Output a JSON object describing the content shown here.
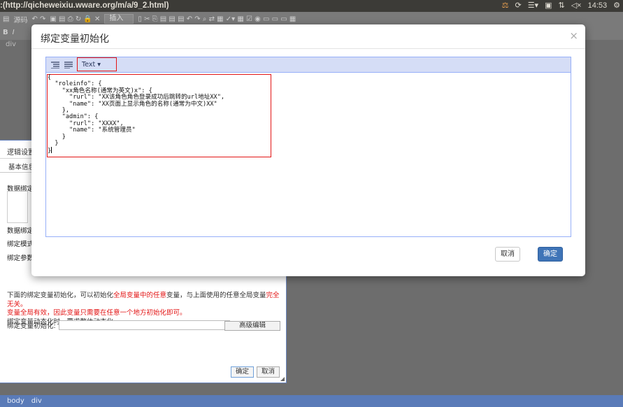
{
  "window": {
    "title": ":(http://qicheweixiu.wware.org/m/a/9_2.html)",
    "time": "14:53"
  },
  "bg_toolbar": {
    "source_label": "源码",
    "insert_label": "插入",
    "bold_label": "B",
    "italic_label": "I",
    "path_tag": "div"
  },
  "logic_dialog": {
    "title": "逻辑设置",
    "tab": "基本信息",
    "label_data_bind": "数据绑定",
    "label_data_bind2": "数据绑定",
    "label_mode": "绑定模式:",
    "label_params": "绑定参数:",
    "info_line1_a": "下面的绑定变量初始化，可以初始化",
    "info_line1_red1": "全局变量中的任意",
    "info_line1_b": "变量，与上面使用的任意全局变量",
    "info_line1_red2": "完全无关。",
    "info_line2": "变量全局有效，因此变量只需要在任意一个地方初始化即可。",
    "info_line3": "绑定变量动态化时，要求整体动态化。",
    "init_label": "绑定变量初始化:",
    "advanced_button": "高级编辑",
    "ok_button": "确定",
    "cancel_button": "取消"
  },
  "status_bar": {
    "path1": "body",
    "path2": "div"
  },
  "modal": {
    "title": "绑定变量初始化",
    "close": "×",
    "mode_label": "Text ▾",
    "code_lines": [
      "{",
      "  \"roleinfo\": {",
      "    \"xx角色名称(通常为英文)x\": {",
      "      \"rurl\": \"XX该角色角色登录成功后跳转的url地址XX\",",
      "      \"name\": \"XX页面上显示角色的名称(通常为中文)XX\"",
      "    },",
      "    \"admin\": {",
      "      \"rurl\": \"XXXX\",",
      "      \"name\": \"系统管理员\"",
      "    }",
      "  }",
      "}"
    ],
    "cancel_button": "取消",
    "ok_button": "确定"
  },
  "colors": {
    "accent_red": "#e31515",
    "primary_blue": "#3f74b7",
    "menu_bg": "#d5ddf6"
  }
}
